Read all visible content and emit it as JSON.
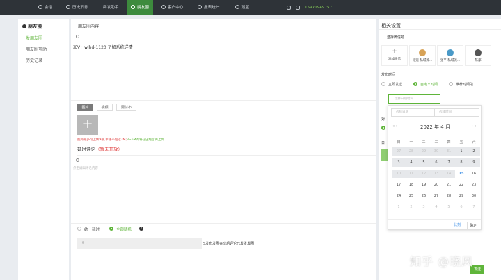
{
  "nav": {
    "items": [
      {
        "label": "会话",
        "icon": "chat-icon"
      },
      {
        "label": "历史消息",
        "icon": "history-icon"
      },
      {
        "label": "群发助手",
        "icon": ""
      },
      {
        "label": "朋友圈",
        "icon": "moments-icon"
      },
      {
        "label": "客户中心",
        "icon": "user-icon"
      },
      {
        "label": "报表统计",
        "icon": "chart-icon"
      },
      {
        "label": "设置",
        "icon": "gear-icon"
      }
    ],
    "phone": "15971949757"
  },
  "sidebar": {
    "title": "朋友圈",
    "items": [
      {
        "label": "发朋友圈"
      },
      {
        "label": "朋友圈互动"
      },
      {
        "label": "历史记录"
      }
    ]
  },
  "main": {
    "title": "朋友圈内容",
    "content": "加V：wlhd-1120  了解系统详情",
    "tabs": [
      "图片",
      "视频",
      "要付布"
    ],
    "warn_red": "图片最多可上传9张,单张不超过3M;",
    "warn_green": "3~5M的将在压缩后再上传",
    "delay_label": "延时评论",
    "delay_note": "（暂未开放）",
    "comment_placeholder": "点击编辑评论内容",
    "option_unified": "统一延时",
    "option_random": "全部随机",
    "number_value": "0",
    "number_desc": "S发布发圈完成后评论已发发发圈"
  },
  "right": {
    "title": "相关设置",
    "select_label": "选择微信号",
    "accounts": [
      {
        "name": "添加微信"
      },
      {
        "name": "除咒-私城流..."
      },
      {
        "name": "张平-私城流..."
      },
      {
        "name": "陈都"
      }
    ],
    "publish_label": "发布时间",
    "opt_now": "立即发送",
    "opt_custom": "自定义时间",
    "opt_recommend": "推荐时间段",
    "picker_placeholder": "选择日期时间",
    "sec_to": "对",
    "sec_ri": "日",
    "colors": {
      "accent": "#5fb53a",
      "link": "#3a8ee6",
      "nav": "#2e3338"
    }
  },
  "datepicker": {
    "date_placeholder": "选择日期",
    "time_placeholder": "选择时间",
    "prev": "« ‹",
    "next": "› »",
    "month_label": "2022 年  4 月",
    "weekdays": [
      "日",
      "一",
      "二",
      "三",
      "四",
      "五",
      "六"
    ],
    "days": [
      [
        "27",
        "28",
        "29",
        "30",
        "31",
        "1",
        "2"
      ],
      [
        "3",
        "4",
        "5",
        "6",
        "7",
        "8",
        "9"
      ],
      [
        "10",
        "11",
        "12",
        "13",
        "14",
        "15",
        "16"
      ],
      [
        "17",
        "18",
        "19",
        "20",
        "21",
        "22",
        "23"
      ],
      [
        "24",
        "25",
        "26",
        "27",
        "28",
        "29",
        "30"
      ],
      [
        "1",
        "2",
        "3",
        "4",
        "5",
        "6",
        "7"
      ]
    ],
    "clear": "此刻",
    "ok": "确定"
  },
  "publish_button": "发送",
  "watermark": "知乎 @晓风"
}
